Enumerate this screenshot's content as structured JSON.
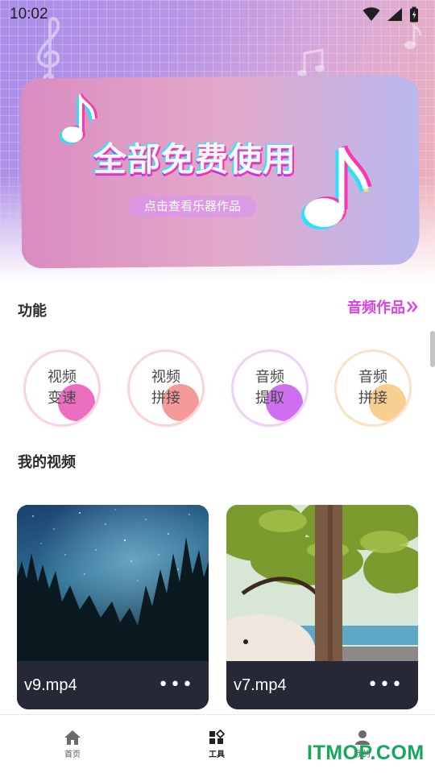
{
  "status_bar": {
    "time": "10:02",
    "icons": [
      "wifi-icon",
      "signal-icon",
      "battery-icon"
    ]
  },
  "banner": {
    "title": "全部免费使用",
    "subtitle": "点击查看乐器作品",
    "decorations": [
      "music-note-icon",
      "treble-clef-icon"
    ]
  },
  "features": {
    "title": "功能",
    "link_label": "音频作品",
    "link_icon": "double-chevron-right-icon",
    "items": [
      {
        "label": "视频变速",
        "line1": "视频",
        "line2": "变速",
        "color": "#ec6fbf",
        "ring": "#f8d3e8"
      },
      {
        "label": "视频拼接",
        "line1": "视频",
        "line2": "拼接",
        "color": "#f59a9a",
        "ring": "#f9d6d6"
      },
      {
        "label": "音频提取",
        "line1": "音频",
        "line2": "提取",
        "color": "#cf6ff0",
        "ring": "#ead3f7"
      },
      {
        "label": "音频拼接",
        "line1": "音频",
        "line2": "拼接",
        "color": "#f9cf91",
        "ring": "#f9e2c7"
      }
    ]
  },
  "my_videos": {
    "title": "我的视频",
    "items": [
      {
        "name": "v9.mp4",
        "thumbnail": "night-sky-forest",
        "more_icon": "more-dots-icon"
      },
      {
        "name": "v7.mp4",
        "thumbnail": "tree-lake-dog",
        "more_icon": "more-dots-icon"
      }
    ]
  },
  "bottom_nav": {
    "items": [
      {
        "label": "首页",
        "icon": "home-icon",
        "active": false
      },
      {
        "label": "工具",
        "icon": "tools-icon",
        "active": true
      },
      {
        "label": "我的",
        "icon": "person-icon",
        "active": false
      }
    ]
  },
  "watermark": "ITMOP.COM"
}
